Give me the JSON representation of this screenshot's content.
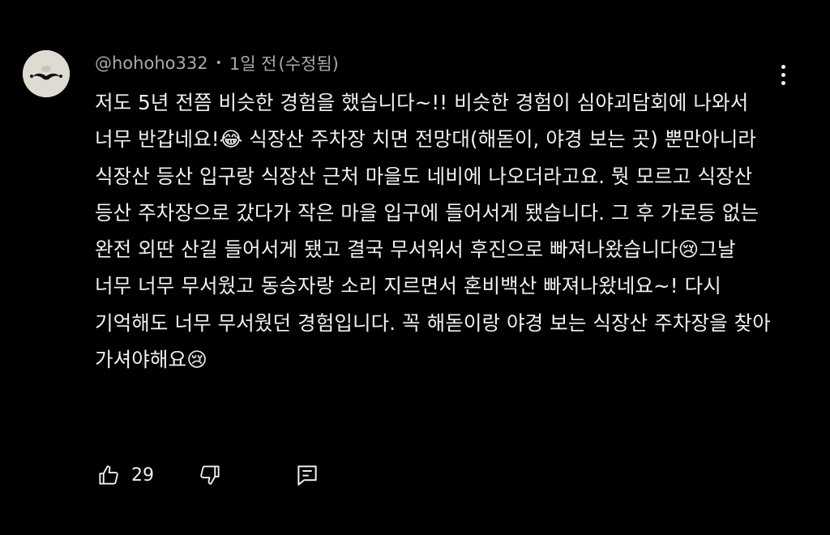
{
  "comment": {
    "author": "@hohoho332",
    "separator": "•",
    "time": "1일 전",
    "edited": "(수정됨)",
    "text": "저도 5년 전쯤 비슷한 경험을 했습니다~!! 비슷한 경험이 심야괴담회에 나와서 너무 반갑네요!😂 식장산 주차장 치면 전망대(해돋이, 야경 보는 곳) 뿐만아니라 식장산 등산 입구랑 식장산 근처 마을도 네비에 나오더라고요. 뭣 모르고 식장산 등산 주차장으로 갔다가 작은 마을 입구에 들어서게 됐습니다. 그 후 가로등 없는 완전 외딴 산길 들어서게 됐고 결국 무서워서 후진으로 빠져나왔습니다😢그날 너무 너무 무서웠고 동승자랑 소리 지르면서 혼비백산 빠져나왔네요~! 다시 기억해도 너무 무서웠던 경험입니다. 꼭 해돋이랑 야경 보는 식장산 주차장을 찾아 가셔야해요😢",
    "like_count": "29"
  },
  "icons": {
    "avatar": "mustache-avatar",
    "menu": "more-vert-icon",
    "like": "thumb-up-icon",
    "dislike": "thumb-down-icon",
    "reply": "reply-comment-icon"
  },
  "colors": {
    "background": "#000000",
    "text": "#f1f1f1",
    "meta": "#aaaaaa"
  }
}
